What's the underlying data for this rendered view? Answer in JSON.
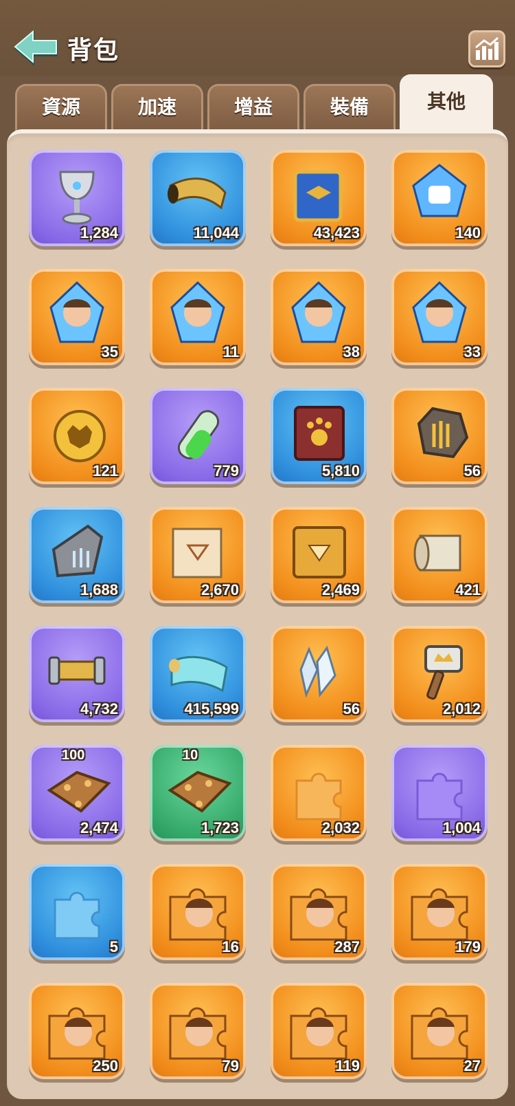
{
  "header": {
    "title": "背包",
    "back_icon": "back-arrow-icon",
    "stats_icon": "stats-chart-icon"
  },
  "tabs": [
    {
      "label": "資源",
      "active": false
    },
    {
      "label": "加速",
      "active": false
    },
    {
      "label": "增益",
      "active": false
    },
    {
      "label": "裝備",
      "active": false
    },
    {
      "label": "其他",
      "active": true
    }
  ],
  "items": [
    {
      "icon": "silver-chalice-icon",
      "bg": "purple",
      "count": "1,284"
    },
    {
      "icon": "golden-horn-icon",
      "bg": "blue",
      "count": "11,044"
    },
    {
      "icon": "academy-book-icon",
      "bg": "orange",
      "count": "43,423"
    },
    {
      "icon": "academy-crystal-icon",
      "bg": "orange",
      "count": "140"
    },
    {
      "icon": "hero-crystal-woman-icon",
      "bg": "orange",
      "count": "35"
    },
    {
      "icon": "hero-crystal-monocle-icon",
      "bg": "orange",
      "count": "11"
    },
    {
      "icon": "hero-crystal-mustache-icon",
      "bg": "orange",
      "count": "38"
    },
    {
      "icon": "hero-crystal-silver-hair-icon",
      "bg": "orange",
      "count": "33"
    },
    {
      "icon": "beast-badge-icon",
      "bg": "orange",
      "count": "121"
    },
    {
      "icon": "green-potion-icon",
      "bg": "purple",
      "count": "779"
    },
    {
      "icon": "paw-book-icon",
      "bg": "blue",
      "count": "5,810"
    },
    {
      "icon": "claw-stone-icon",
      "bg": "orange",
      "count": "56"
    },
    {
      "icon": "silver-claw-stone-icon",
      "bg": "blue",
      "count": "1,688"
    },
    {
      "icon": "gem-scroll-icon",
      "bg": "orange",
      "count": "2,670"
    },
    {
      "icon": "gem-book-icon",
      "bg": "orange",
      "count": "2,469"
    },
    {
      "icon": "blueprint-scroll-icon",
      "bg": "orange",
      "count": "421"
    },
    {
      "icon": "thread-spool-icon",
      "bg": "purple",
      "count": "4,732"
    },
    {
      "icon": "cloth-roll-icon",
      "bg": "blue",
      "count": "415,599"
    },
    {
      "icon": "crystal-cluster-icon",
      "bg": "orange",
      "count": "56"
    },
    {
      "icon": "crown-hammer-icon",
      "bg": "orange",
      "count": "2,012"
    },
    {
      "icon": "bronze-plate-icon",
      "bg": "purple",
      "count": "2,474",
      "top_label": "100"
    },
    {
      "icon": "bronze-plate-icon",
      "bg": "green",
      "count": "1,723",
      "top_label": "10"
    },
    {
      "icon": "orange-puzzle-piece-icon",
      "bg": "orange",
      "count": "2,032"
    },
    {
      "icon": "purple-puzzle-piece-icon",
      "bg": "purple",
      "count": "1,004"
    },
    {
      "icon": "blue-puzzle-piece-icon",
      "bg": "blue",
      "count": "5"
    },
    {
      "icon": "hero-puzzle-redhead-icon",
      "bg": "orange",
      "count": "16"
    },
    {
      "icon": "hero-puzzle-boy-icon",
      "bg": "orange",
      "count": "287"
    },
    {
      "icon": "hero-puzzle-spartan-icon",
      "bg": "orange",
      "count": "179"
    },
    {
      "icon": "hero-puzzle-bangs-girl-icon",
      "bg": "orange",
      "count": "250"
    },
    {
      "icon": "hero-puzzle-old-man-icon",
      "bg": "orange",
      "count": "79"
    },
    {
      "icon": "hero-puzzle-dark-hair-icon",
      "bg": "orange",
      "count": "119"
    },
    {
      "icon": "hero-puzzle-red-hair-girl-icon",
      "bg": "orange",
      "count": "27"
    }
  ]
}
